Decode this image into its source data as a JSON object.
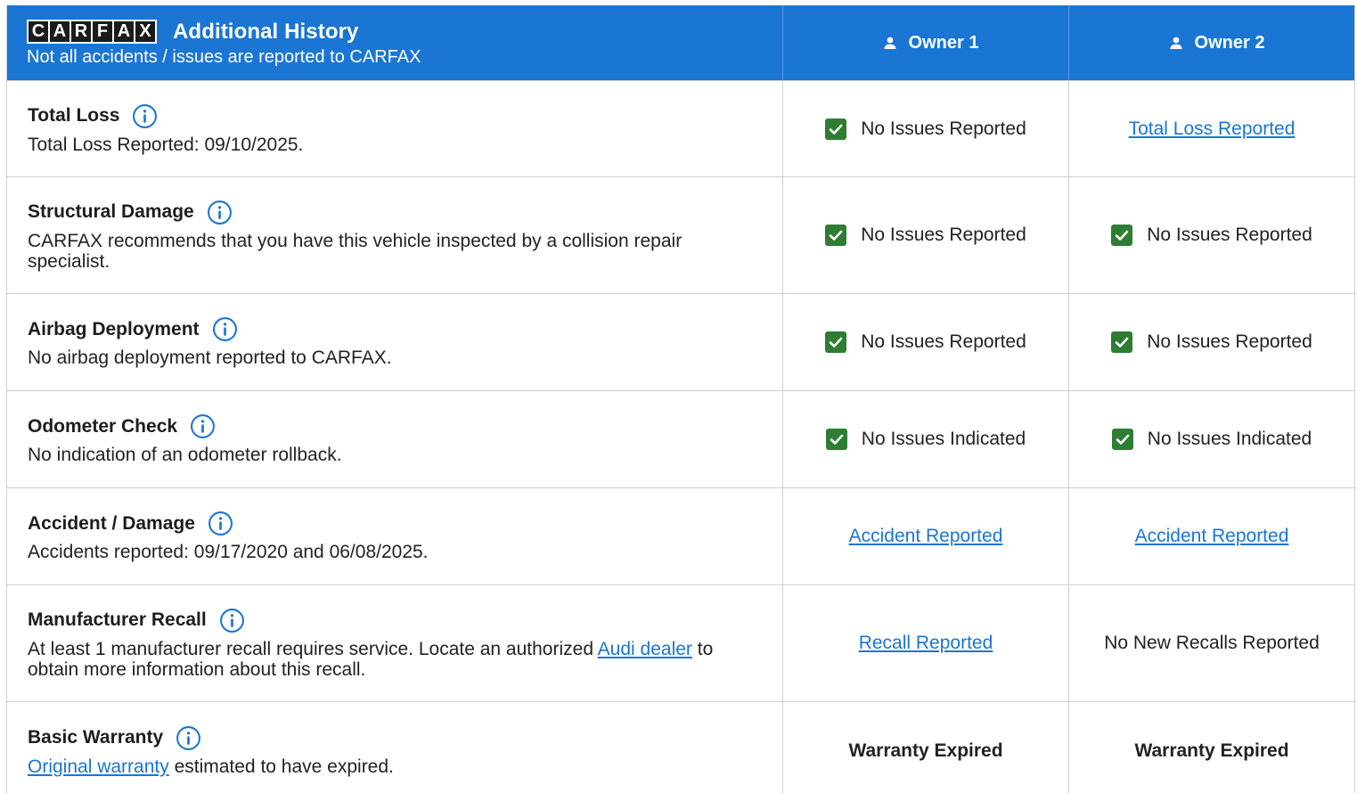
{
  "header": {
    "logo_letters": [
      "C",
      "A",
      "R",
      "F",
      "A",
      "X"
    ],
    "title": "Additional History",
    "subtitle": "Not all accidents / issues are reported to CARFAX",
    "owners": [
      "Owner 1",
      "Owner 2"
    ]
  },
  "rows": [
    {
      "title": "Total Loss",
      "desc": "Total Loss Reported: 09/10/2025.",
      "owner1": {
        "type": "ok",
        "text": "No Issues Reported"
      },
      "owner2": {
        "type": "link",
        "text": "Total Loss Reported"
      }
    },
    {
      "title": "Structural Damage",
      "desc": "CARFAX recommends that you have this vehicle inspected by a collision repair specialist.",
      "owner1": {
        "type": "ok",
        "text": "No Issues Reported"
      },
      "owner2": {
        "type": "ok",
        "text": "No Issues Reported"
      }
    },
    {
      "title": "Airbag Deployment",
      "desc": "No airbag deployment reported to CARFAX.",
      "owner1": {
        "type": "ok",
        "text": "No Issues Reported"
      },
      "owner2": {
        "type": "ok",
        "text": "No Issues Reported"
      }
    },
    {
      "title": "Odometer Check",
      "desc": "No indication of an odometer rollback.",
      "owner1": {
        "type": "ok",
        "text": "No Issues Indicated"
      },
      "owner2": {
        "type": "ok",
        "text": "No Issues Indicated"
      }
    },
    {
      "title": "Accident / Damage",
      "desc": "Accidents reported: 09/17/2020 and 06/08/2025.",
      "owner1": {
        "type": "link",
        "text": "Accident Reported"
      },
      "owner2": {
        "type": "link",
        "text": "Accident Reported"
      }
    },
    {
      "title": "Manufacturer Recall",
      "desc_pre": "At least 1 manufacturer recall requires service. Locate an authorized ",
      "desc_link": "Audi dealer",
      "desc_post": " to obtain more information about this recall.",
      "owner1": {
        "type": "link",
        "text": "Recall Reported"
      },
      "owner2": {
        "type": "text",
        "text": "No New Recalls Reported"
      }
    },
    {
      "title": "Basic Warranty",
      "desc_link": "Original warranty",
      "desc_post": " estimated to have expired.",
      "owner1": {
        "type": "bold",
        "text": "Warranty Expired"
      },
      "owner2": {
        "type": "bold",
        "text": "Warranty Expired"
      }
    }
  ],
  "colors": {
    "header_blue": "#1a76d2",
    "check_green": "#2e7d32",
    "link_blue": "#1a76d2"
  }
}
